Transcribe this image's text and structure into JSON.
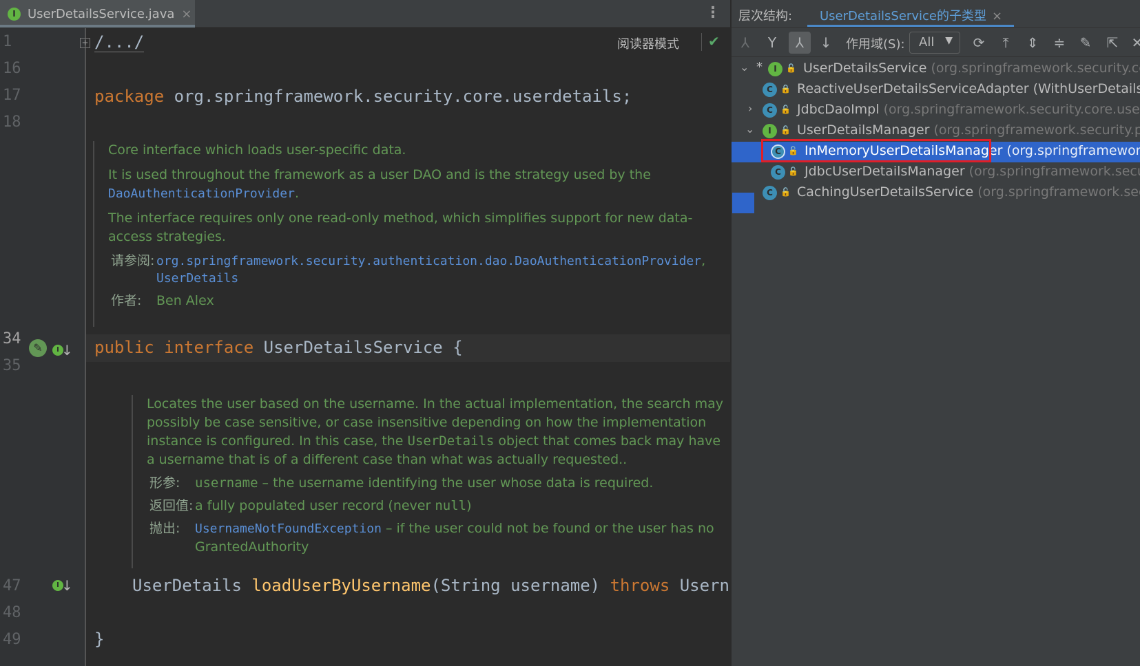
{
  "editor": {
    "tab_label": "UserDetailsService.java",
    "tab_icon": "interface-icon",
    "reader_mode": "阅读器模式",
    "line_numbers": [
      "1",
      "16",
      "17",
      "18",
      "34",
      "35",
      "47",
      "48",
      "49"
    ],
    "code": {
      "folded": "/.../",
      "package_kw": "package",
      "package_name": " org.springframework.security.core.userdetails;",
      "public_kw": "public",
      "interface_kw": " interface",
      "interface_name": " UserDetailsService {",
      "method_type": "UserDetails ",
      "method_name": "loadUserByUsername",
      "method_params": "(String username) ",
      "throws_kw": "throws",
      "throws_rest": " Usernam",
      "closing": "}"
    },
    "doc1": {
      "line1": "Core interface which loads user-specific data.",
      "line2a": "It is used throughout the framework as a user DAO and is the strategy used by the",
      "line2b": "DaoAuthenticationProvider",
      "line2c": ".",
      "line3a": "The interface requires only one read-only method, which simplifies support for new data-",
      "line3b": "access strategies.",
      "see_label": "请参阅:",
      "see_link1": "org.springframework.security.authentication.dao.DaoAuthenticationProvider",
      "see_comma": ",",
      "see_link2": "UserDetails",
      "author_label": "作者:",
      "author": "Ben Alex"
    },
    "doc2": {
      "l1": "Locates the user based on the username. In the actual implementation, the search may",
      "l2": "possibly be case sensitive, or case insensitive depending on how the implementation",
      "l3a": "instance is configured. In this case, the ",
      "l3b": "UserDetails",
      "l3c": " object that comes back may have",
      "l4": "a username that is of a different case than what was actually requested..",
      "param_label": "形参:",
      "param_name": "username",
      "param_desc": " – the username identifying the user whose data is required.",
      "return_label": "返回值:",
      "return_a": "a fully populated user record (never ",
      "return_b": "null",
      "return_c": ")",
      "throws_label": "抛出:",
      "throws_link": "UsernameNotFoundException",
      "throws_desc": " – if the user could not be found or the user has no",
      "throws_desc2": "GrantedAuthority"
    }
  },
  "hierarchy": {
    "title": "层次结构:",
    "tab_label": "UserDetailsService的子类型",
    "scope_label": "作用域(S):",
    "scope_value": "All",
    "toolbar_icons": [
      "supertypes-icon",
      "subtypes-icon",
      "type-hierarchy-icon",
      "sort-icon",
      "refresh-icon",
      "scroll-to-source-icon",
      "expand-all-icon",
      "collapse-all-icon",
      "pin-icon",
      "open-in-window-icon",
      "close-icon"
    ],
    "tree": [
      {
        "name": "UserDetailsService",
        "pkg": " (org.springframework.security.core",
        "kind": "I",
        "vis": "public",
        "expander": "expanded",
        "star": "*",
        "level": 0
      },
      {
        "name": "ReactiveUserDetailsServiceAdapter",
        "pkg": " (WithUserDetailsSe",
        "kind": "C",
        "vis": "private",
        "expander": "",
        "star": "",
        "level": 1
      },
      {
        "name": "JdbcDaoImpl",
        "pkg": " (org.springframework.security.core.userd",
        "kind": "C",
        "vis": "public",
        "expander": "collapsed",
        "star": "",
        "level": 1
      },
      {
        "name": "UserDetailsManager",
        "pkg": " (org.springframework.security.pro",
        "kind": "I",
        "vis": "public",
        "expander": "expanded",
        "star": "",
        "level": 1
      },
      {
        "name": "InMemoryUserDetailsManager",
        "pkg": " (org.springframework.",
        "kind": "C",
        "vis": "public",
        "expander": "",
        "star": "",
        "level": 2,
        "selected": true
      },
      {
        "name": "JdbcUserDetailsManager",
        "pkg": " (org.springframework.securi",
        "kind": "C",
        "vis": "public",
        "expander": "",
        "star": "",
        "level": 2
      },
      {
        "name": "CachingUserDetailsService",
        "pkg": " (org.springframework.secur",
        "kind": "C",
        "vis": "public",
        "expander": "",
        "star": "",
        "level": 1
      }
    ]
  },
  "colors": {
    "keyword": "#cc7832",
    "function": "#ffc66d",
    "doc": "#629755",
    "link": "#5a8fd6",
    "selection": "#2f65ca",
    "highlight_box": "#e01f28"
  }
}
